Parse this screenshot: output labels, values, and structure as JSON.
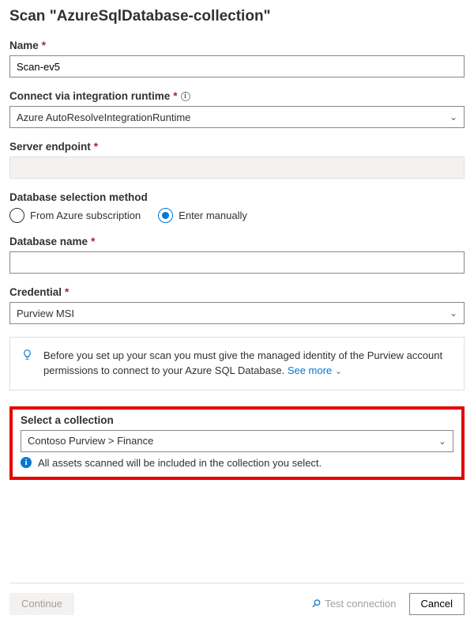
{
  "title": "Scan \"AzureSqlDatabase-collection\"",
  "fields": {
    "name": {
      "label": "Name",
      "value": "Scan-ev5"
    },
    "runtime": {
      "label": "Connect via integration runtime",
      "value": "Azure AutoResolveIntegrationRuntime"
    },
    "endpoint": {
      "label": "Server endpoint",
      "value": ""
    },
    "dbmethod": {
      "label": "Database selection method",
      "options": {
        "sub": "From Azure subscription",
        "manual": "Enter manually"
      },
      "selected": "manual"
    },
    "dbname": {
      "label": "Database name",
      "value": ""
    },
    "credential": {
      "label": "Credential",
      "value": "Purview MSI"
    },
    "collection": {
      "label": "Select a collection",
      "value": "Contoso Purview > Finance"
    }
  },
  "tip": {
    "text": "Before you set up your scan you must give the managed identity of the Purview account permissions to connect to your Azure SQL Database.",
    "see_more": "See more"
  },
  "collection_info": "All assets scanned will be included in the collection you select.",
  "buttons": {
    "continue": "Continue",
    "test": "Test connection",
    "cancel": "Cancel"
  }
}
